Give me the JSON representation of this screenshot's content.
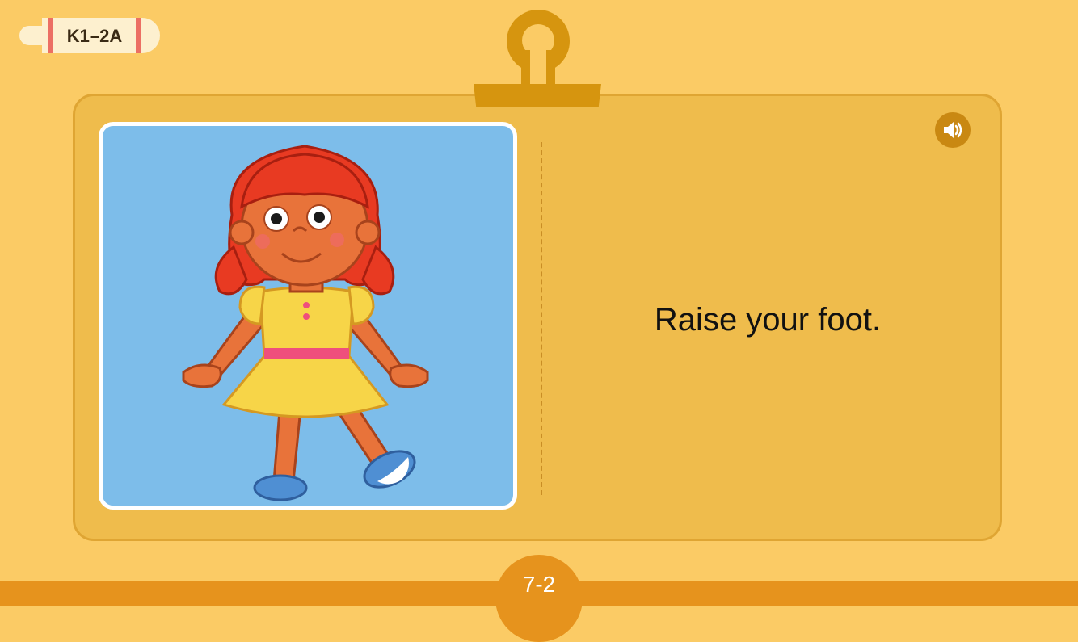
{
  "level_tag": {
    "label": "K1–2A"
  },
  "card": {
    "image_alt": "girl-illustration",
    "sentence": "Raise your foot.",
    "sound_icon": "speaker-icon"
  },
  "footer": {
    "page": "7-2"
  },
  "colors": {
    "background": "#fbcb65",
    "card": "#efbc4c",
    "accent": "#d6950f",
    "bottom_bar": "#e6931d"
  }
}
